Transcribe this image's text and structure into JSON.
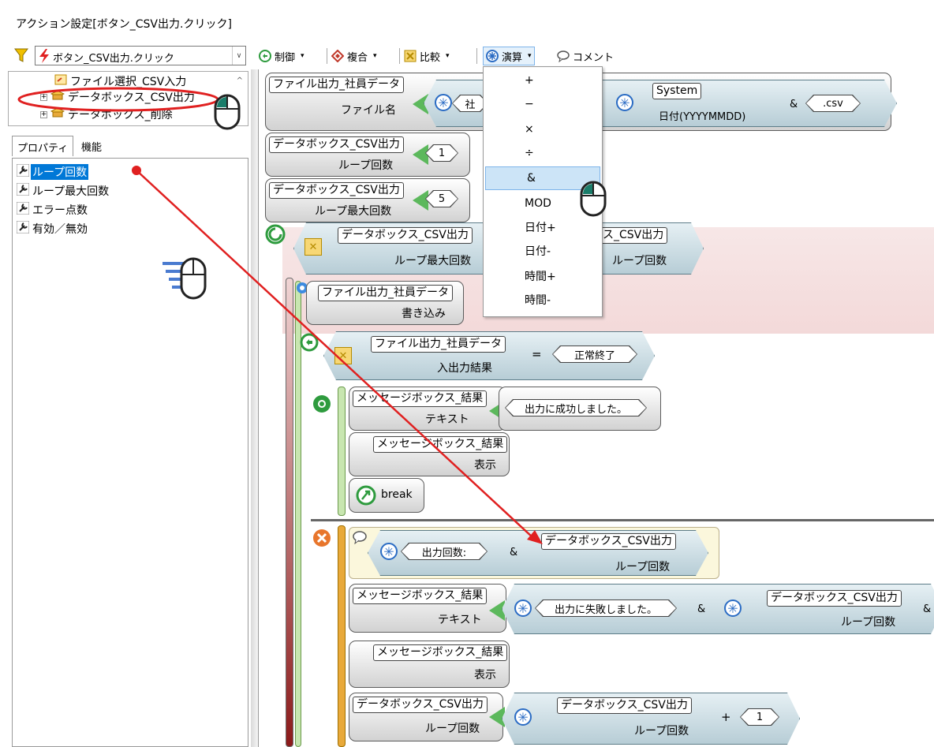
{
  "window": {
    "title": "アクション設定[ボタン_CSV出力.クリック]"
  },
  "event_selector": {
    "value": "ボタン_CSV出力.クリック"
  },
  "toolbar": {
    "control_label": "制御",
    "composite_label": "複合",
    "compare_label": "比較",
    "operation_label": "演算",
    "comment_label": "コメント"
  },
  "tree": {
    "items": [
      {
        "label": "ファイル選択_CSV入力"
      },
      {
        "label": "データボックス_CSV出力"
      },
      {
        "label": "データボックス_削除"
      }
    ]
  },
  "panel_tabs": [
    "プロパティ",
    "機能"
  ],
  "properties": [
    {
      "label": "ループ回数",
      "selected": true
    },
    {
      "label": "ループ最大回数"
    },
    {
      "label": "エラー点数"
    },
    {
      "label": "有効／無効"
    }
  ],
  "operation_menu": {
    "items": [
      "+",
      "−",
      "×",
      "÷",
      "&",
      "MOD",
      "日付+",
      "日付-",
      "時間+",
      "時間-"
    ],
    "highlighted": "&"
  },
  "flow": {
    "row1": {
      "target": "ファイル出力_社員データ",
      "prop": "ファイル名",
      "op1_text": "社",
      "sys": "System",
      "sys_prop": "日付(YYYYMMDD)",
      "amp": "&",
      "ext": ".csv"
    },
    "row2": {
      "target": "データボックス_CSV出力",
      "prop": "ループ回数",
      "value": "1"
    },
    "row3": {
      "target": "データボックス_CSV出力",
      "prop": "ループ最大回数",
      "value": "5"
    },
    "loop": {
      "left": "データボックス_CSV出力",
      "left_prop": "ループ最大回数",
      "right": "ス_CSV出力",
      "right_prop": "ループ回数"
    },
    "write": {
      "target": "ファイル出力_社員データ",
      "action": "書き込み"
    },
    "if": {
      "target": "ファイル出力_社員データ",
      "prop": "入出力結果",
      "eq": "=",
      "value": "正常終了"
    },
    "success": {
      "msg_target": "メッセージボックス_結果",
      "msg_prop": "テキスト",
      "msg_value": "出力に成功しました。",
      "show_target": "メッセージボックス_結果",
      "show_action": "表示",
      "break": "break"
    },
    "failure": {
      "comment_text": "出力回数:",
      "comment_amp": "&",
      "comment_target": "データボックス_CSV出力",
      "comment_prop": "ループ回数",
      "msg_target": "メッセージボックス_結果",
      "msg_prop": "テキスト",
      "msg_value": "出力に失敗しました。",
      "msg_amp": "&",
      "msg_ref": "データボックス_CSV出力",
      "msg_ref_prop": "ループ回数",
      "msg_amp2": "&",
      "show_target": "メッセージボックス_結果",
      "show_action": "表示",
      "inc_target": "データボックス_CSV出力",
      "inc_prop": "ループ回数",
      "inc_ref": "データボックス_CSV出力",
      "inc_ref_prop": "ループ回数",
      "inc_plus": "+",
      "inc_value": "1"
    }
  },
  "colors": {
    "accent_red": "#e02020",
    "selection": "#0078d7",
    "assign_green": "#5cb85c",
    "menu_highlight": "#cce4f7",
    "rail_red": "#8b1a1a",
    "rail_orange": "#e8a93a"
  }
}
